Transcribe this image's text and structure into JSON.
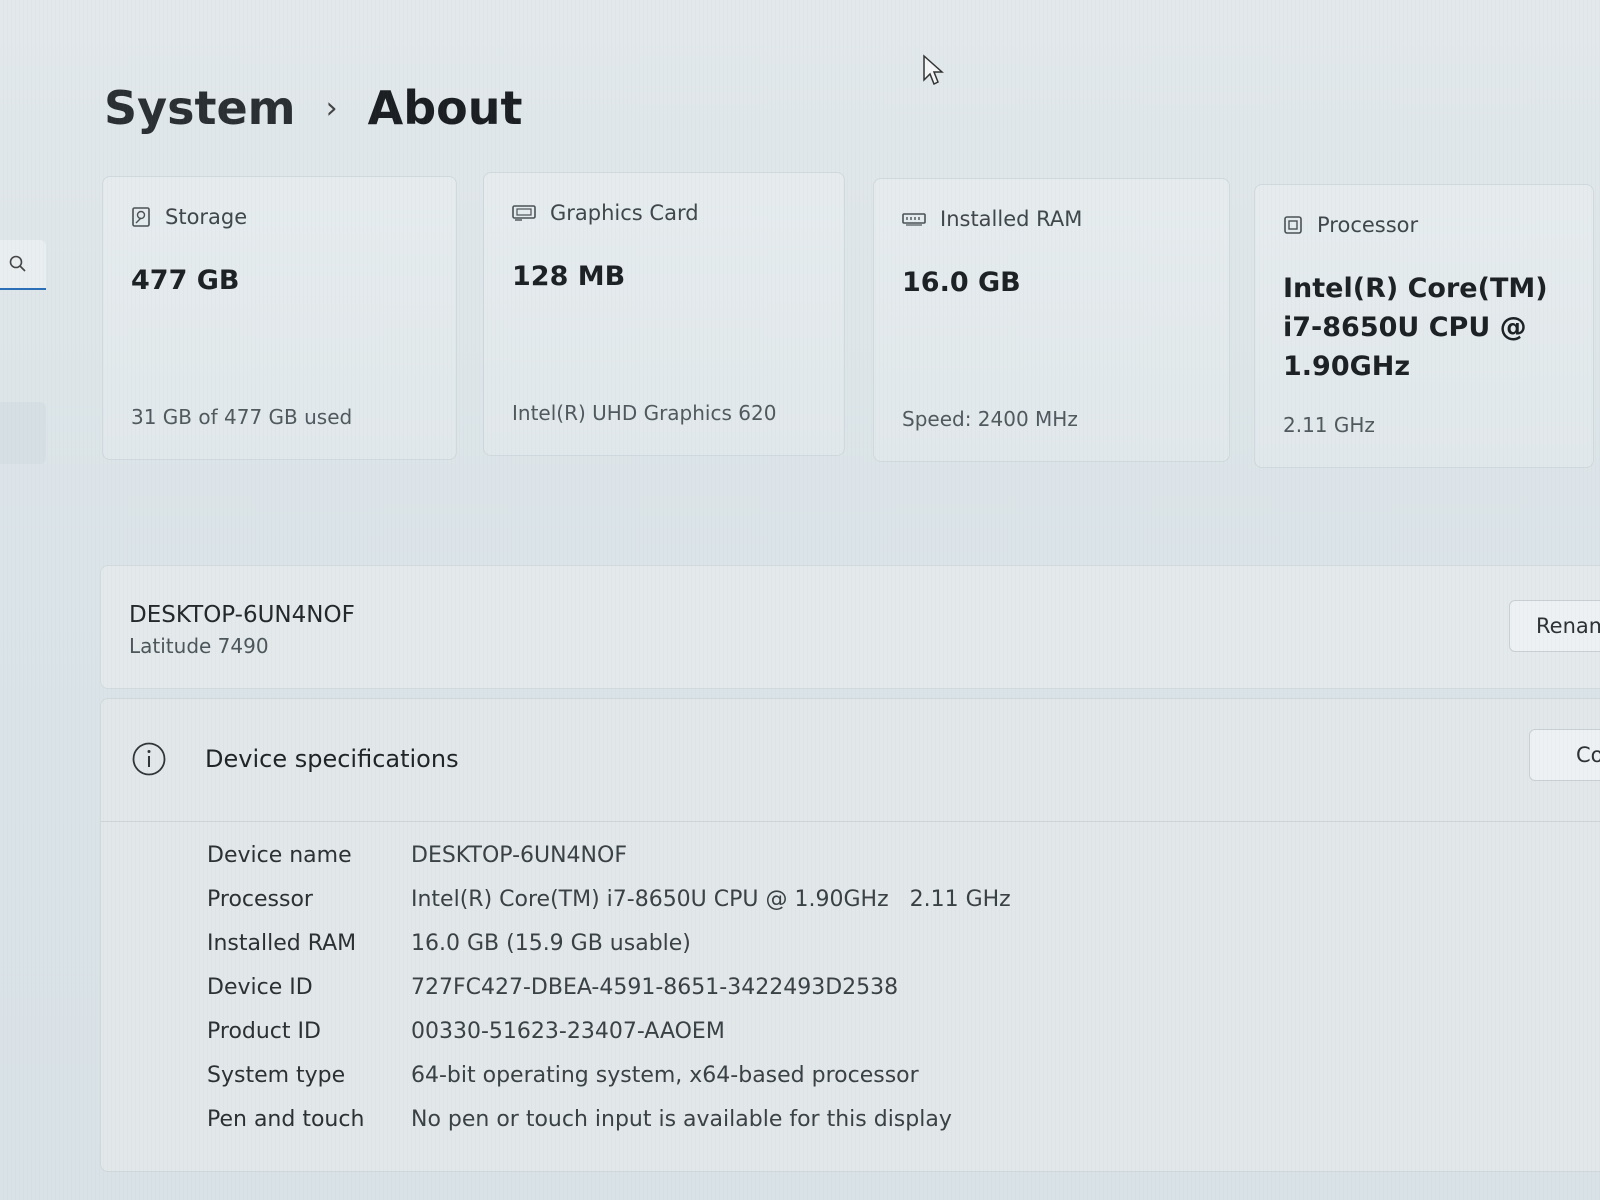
{
  "breadcrumb": {
    "parent": "System",
    "separator": "›",
    "current": "About"
  },
  "nav": {
    "search_icon": "search-icon"
  },
  "cards": {
    "storage": {
      "icon": "storage-icon",
      "title": "Storage",
      "value": "477 GB",
      "sub": "31 GB of 477 GB used"
    },
    "graphics": {
      "icon": "graphics-card-icon",
      "title": "Graphics Card",
      "value": "128 MB",
      "sub": "Intel(R) UHD Graphics 620"
    },
    "ram": {
      "icon": "ram-icon",
      "title": "Installed RAM",
      "value": "16.0 GB",
      "sub": "Speed: 2400 MHz"
    },
    "processor": {
      "icon": "processor-icon",
      "title": "Processor",
      "value_lines": [
        "Intel(R) Core(TM)",
        "i7-8650U CPU @",
        "1.90GHz"
      ],
      "sub": "2.11 GHz"
    }
  },
  "device": {
    "name": "DESKTOP-6UN4NOF",
    "model": "Latitude 7490",
    "rename_label": "Renam"
  },
  "specs": {
    "title": "Device specifications",
    "copy_label": "Co",
    "rows": [
      {
        "label": "Device name",
        "value": "DESKTOP-6UN4NOF"
      },
      {
        "label": "Processor",
        "value": "Intel(R) Core(TM) i7-8650U CPU @ 1.90GHz   2.11 GHz"
      },
      {
        "label": "Installed RAM",
        "value": "16.0 GB (15.9 GB usable)"
      },
      {
        "label": "Device ID",
        "value": "727FC427-DBEA-4591-8651-3422493D2538"
      },
      {
        "label": "Product ID",
        "value": "00330-51623-23407-AAOEM"
      },
      {
        "label": "System type",
        "value": "64-bit operating system, x64-based processor"
      },
      {
        "label": "Pen and touch",
        "value": "No pen or touch input is available for this display"
      }
    ]
  },
  "colors": {
    "accent": "#2a6fb8",
    "background": "#dde5e8",
    "card": "#e4eaec"
  }
}
